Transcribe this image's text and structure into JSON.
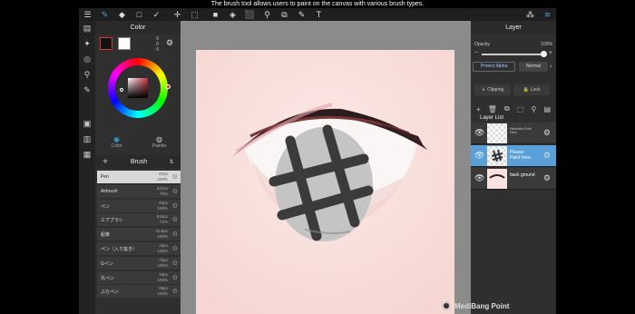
{
  "caption": "The brush tool allows users to paint on the canvas with various brush types.",
  "colors": {
    "accent": "#3aa0e0",
    "foreground": "#111111",
    "background": "#ffffff",
    "layer_active": "#5aa0d8"
  },
  "toolbar": {
    "menu_icon": "☰",
    "tools": [
      "✎",
      "◆",
      "□",
      "✓",
      "✛",
      "⬚",
      "■",
      "◈",
      "⬛",
      "⚲",
      "⧉",
      "✎",
      "T"
    ],
    "right_icons": [
      "⁂",
      "≋"
    ]
  },
  "left_toolbar": [
    "▤",
    "✦",
    "◎",
    "⚲",
    "✎",
    "▣",
    "▥",
    "▦"
  ],
  "color_panel": {
    "title": "Color",
    "rgb": [
      "0",
      "0",
      "0"
    ],
    "modes": [
      {
        "icon": "◉",
        "label": "Color"
      },
      {
        "icon": "◍",
        "label": "Palette"
      }
    ]
  },
  "brush": {
    "title": "Brush",
    "add_label": "+",
    "sort_label": "⇅",
    "items": [
      {
        "name": "Pen",
        "size": "87px",
        "opacity": "100%"
      },
      {
        "name": "Airbrush",
        "size": "237px",
        "opacity": "78%"
      },
      {
        "name": "ペン",
        "size": "94px",
        "opacity": "100%"
      },
      {
        "name": "エアブラシ",
        "size": "534px",
        "opacity": "72%"
      },
      {
        "name": "鉛筆",
        "size": "10.8px",
        "opacity": "100%"
      },
      {
        "name": "ペン（入り抜き）",
        "size": "18px",
        "opacity": "100%"
      },
      {
        "name": "Gペン",
        "size": "75px",
        "opacity": "100%"
      },
      {
        "name": "丸ペン",
        "size": "19px",
        "opacity": "100%"
      },
      {
        "name": "ぶらペン",
        "size": "89px",
        "opacity": "100%"
      }
    ]
  },
  "layer_panel": {
    "title": "Layer",
    "opacity_label": "Opacity",
    "opacity_value": "100%",
    "opacity_level": 1.0,
    "protect_alpha": "Protect Alpha",
    "blend_mode": "Normal",
    "clipping": "Clipping",
    "lock": "Lock",
    "tool_icons": [
      "+",
      "🗑",
      "⧉",
      "⬚",
      "⚲",
      "▤"
    ],
    "list_title": "Layer List",
    "layers": [
      {
        "name": "Kakuritsu Point Here.",
        "active": false
      },
      {
        "name": "Please Paint here.",
        "active": true
      },
      {
        "name": "back ground",
        "active": false
      }
    ]
  },
  "watermark": "MediBang Point"
}
